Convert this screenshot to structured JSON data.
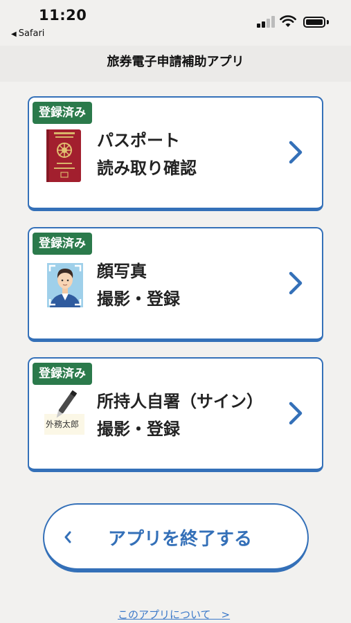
{
  "status_bar": {
    "time": "11:20",
    "back_app": "Safari"
  },
  "nav": {
    "title": "旅券電子申請補助アプリ"
  },
  "cards": [
    {
      "badge": "登録済み",
      "line1": "パスポート",
      "line2": "読み取り確認",
      "icon": "passport-icon"
    },
    {
      "badge": "登録済み",
      "line1": "顔写真",
      "line2": "撮影・登録",
      "icon": "face-photo-icon"
    },
    {
      "badge": "登録済み",
      "line1": "所持人自署（サイン）",
      "line2": "撮影・登録",
      "icon": "signature-icon",
      "signature_text": "外務太郎"
    }
  ],
  "exit_button": {
    "label": "アプリを終了する"
  },
  "about_link": {
    "label": "このアプリについて　>"
  },
  "colors": {
    "accent": "#3470b8",
    "badge": "#2b7a4b",
    "background": "#f2f1ef",
    "passport_cover": "#a21f2e"
  }
}
